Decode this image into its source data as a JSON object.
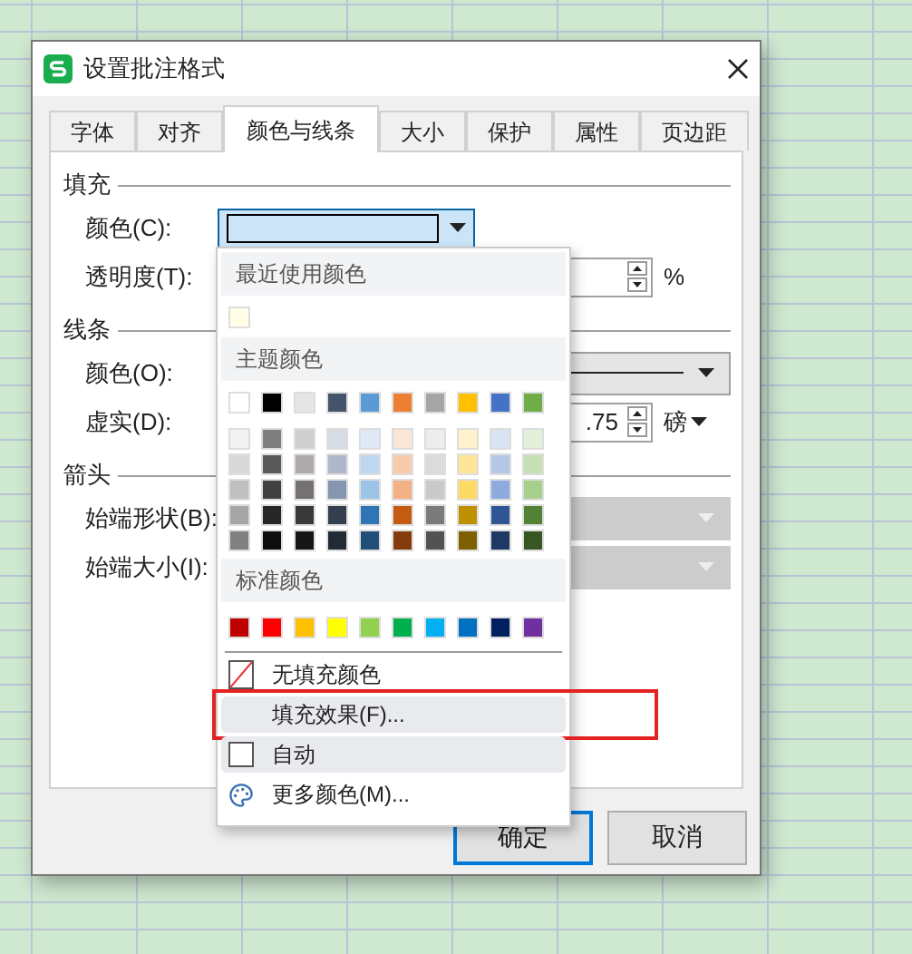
{
  "window": {
    "title": "设置批注格式"
  },
  "tabs": [
    {
      "label": "字体",
      "selected": false
    },
    {
      "label": "对齐",
      "selected": false
    },
    {
      "label": "颜色与线条",
      "selected": true
    },
    {
      "label": "大小",
      "selected": false
    },
    {
      "label": "保护",
      "selected": false
    },
    {
      "label": "属性",
      "selected": false
    },
    {
      "label": "页边距",
      "selected": false
    }
  ],
  "fill": {
    "heading": "填充",
    "color_label": "颜色(C):",
    "transparency_label": "透明度(T):",
    "transparency_unit": "%"
  },
  "line": {
    "heading": "线条",
    "color_label": "颜色(O):",
    "dash_label": "虚实(D):",
    "weight_value": ".75",
    "weight_unit": "磅"
  },
  "arrows": {
    "heading": "箭头",
    "begin_style_label": "始端形状(B):",
    "begin_size_label": "始端大小(I):",
    "disabled": true
  },
  "color_menu": {
    "recent_heading": "最近使用颜色",
    "recent": [
      {
        "color": "#fffde6"
      }
    ],
    "theme_heading": "主题颜色",
    "theme": [
      {
        "color": "#ffffff"
      },
      {
        "color": "#000000"
      },
      {
        "color": "#e7e6e6"
      },
      {
        "color": "#44546a"
      },
      {
        "color": "#5b9bd5"
      },
      {
        "color": "#ed7d31"
      },
      {
        "color": "#a5a5a5"
      },
      {
        "color": "#ffc000"
      },
      {
        "color": "#4472c4"
      },
      {
        "color": "#70ad47"
      }
    ],
    "shades": [
      [
        {
          "color": "#f2f2f2"
        },
        {
          "color": "#7f7f7f"
        },
        {
          "color": "#d0cece"
        },
        {
          "color": "#d6dce4"
        },
        {
          "color": "#deebf6"
        },
        {
          "color": "#fbe5d5"
        },
        {
          "color": "#ededed"
        },
        {
          "color": "#fff2cc"
        },
        {
          "color": "#dae3f3"
        },
        {
          "color": "#e2efd9"
        }
      ],
      [
        {
          "color": "#d9d9d9"
        },
        {
          "color": "#595959"
        },
        {
          "color": "#afabab"
        },
        {
          "color": "#adb9ca"
        },
        {
          "color": "#bdd7ee"
        },
        {
          "color": "#f8cbad"
        },
        {
          "color": "#dbdbdb"
        },
        {
          "color": "#fee599"
        },
        {
          "color": "#b4c7e7"
        },
        {
          "color": "#c5e0b3"
        }
      ],
      [
        {
          "color": "#bfbfbf"
        },
        {
          "color": "#404040"
        },
        {
          "color": "#757171"
        },
        {
          "color": "#8496b0"
        },
        {
          "color": "#9dc3e6"
        },
        {
          "color": "#f4b183"
        },
        {
          "color": "#c9c9c9"
        },
        {
          "color": "#ffd966"
        },
        {
          "color": "#8faadc"
        },
        {
          "color": "#a8d08d"
        }
      ],
      [
        {
          "color": "#a6a6a6"
        },
        {
          "color": "#262626"
        },
        {
          "color": "#3a3838"
        },
        {
          "color": "#333f4f"
        },
        {
          "color": "#2e75b5"
        },
        {
          "color": "#c55a11"
        },
        {
          "color": "#7b7b7b"
        },
        {
          "color": "#bf9000"
        },
        {
          "color": "#2f5597"
        },
        {
          "color": "#538135"
        }
      ],
      [
        {
          "color": "#808080"
        },
        {
          "color": "#0d0d0d"
        },
        {
          "color": "#171616"
        },
        {
          "color": "#222a35"
        },
        {
          "color": "#1f4e79"
        },
        {
          "color": "#843c0c"
        },
        {
          "color": "#525252"
        },
        {
          "color": "#7f6000"
        },
        {
          "color": "#203864"
        },
        {
          "color": "#375623"
        }
      ]
    ],
    "standard_heading": "标准颜色",
    "standard": [
      {
        "color": "#c00000"
      },
      {
        "color": "#ff0000"
      },
      {
        "color": "#ffc000"
      },
      {
        "color": "#ffff00"
      },
      {
        "color": "#92d050"
      },
      {
        "color": "#00b050"
      },
      {
        "color": "#00b0f0"
      },
      {
        "color": "#0070c0"
      },
      {
        "color": "#002060"
      },
      {
        "color": "#7030a0"
      }
    ],
    "items": [
      {
        "kind": "no_fill",
        "label": "无填充颜色",
        "highlighted": false,
        "annotated": false
      },
      {
        "kind": "effects",
        "label": "填充效果(F)...",
        "highlighted": true,
        "annotated": true
      },
      {
        "kind": "auto",
        "label": "自动",
        "highlighted": true,
        "annotated": false
      },
      {
        "kind": "more",
        "label": "更多颜色(M)...",
        "highlighted": false,
        "annotated": false
      }
    ]
  },
  "buttons": [
    {
      "label": "确定",
      "default": true
    },
    {
      "label": "取消",
      "default": false
    }
  ]
}
